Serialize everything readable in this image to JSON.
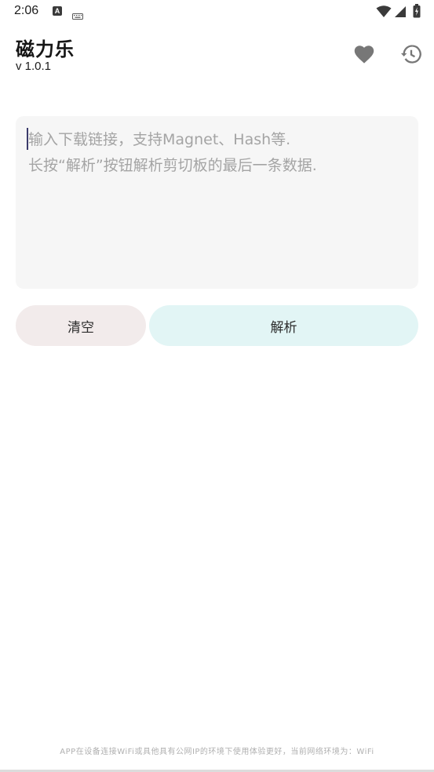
{
  "status_bar": {
    "time": "2:06",
    "notification_icon_letter": "A",
    "icons": [
      "keyboard-icon",
      "wifi-icon",
      "signal-icon",
      "battery-icon"
    ]
  },
  "header": {
    "title": "磁力乐",
    "version": "v 1.0.1",
    "actions": [
      "heart-icon",
      "history-icon"
    ]
  },
  "input": {
    "value": "",
    "placeholder": "输入下载链接，支持Magnet、Hash等.\n长按“解析”按钮解析剪切板的最后一条数据."
  },
  "buttons": {
    "clear_label": "清空",
    "parse_label": "解析"
  },
  "footer": {
    "note": "APP在设备连接WiFi或具他具有公网IP的环境下使用体验更好，当前网络环境为：WiFi"
  },
  "colors": {
    "background": "#ffffff",
    "input_bg": "#f6f6f6",
    "clear_button_bg": "#f2ebeb",
    "parse_button_bg": "#e2f5f5",
    "icon_gray": "#757575",
    "footer_text": "#b0b0b0"
  }
}
